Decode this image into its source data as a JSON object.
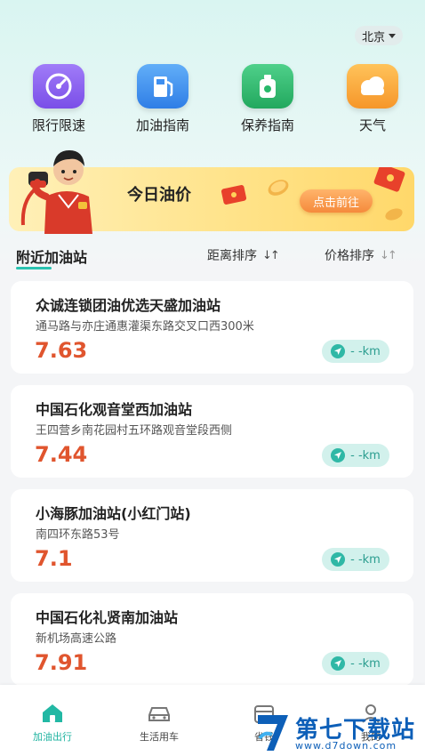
{
  "header": {
    "city": "北京"
  },
  "quick_nav": [
    {
      "label": "限行限速",
      "icon": "speedometer-icon",
      "color": "#8a62f0"
    },
    {
      "label": "加油指南",
      "icon": "fuel-pump-icon",
      "color": "#3e8ff0"
    },
    {
      "label": "保养指南",
      "icon": "oil-bottle-icon",
      "color": "#28b86a"
    },
    {
      "label": "天气",
      "icon": "weather-cloud-icon",
      "color": "#f6a234"
    }
  ],
  "banner": {
    "title": "今日油价",
    "button": "点击前往"
  },
  "list_header": {
    "tab": "附近加油站",
    "sort_distance": "距离排序",
    "sort_price": "价格排序"
  },
  "stations": [
    {
      "name": "众诚连锁团油优选天盛加油站",
      "address": "通马路与亦庄通惠灌渠东路交叉口西300米",
      "price": "7.63",
      "distance": "- -km"
    },
    {
      "name": "中国石化观音堂西加油站",
      "address": "王四营乡南花园村五环路观音堂段西侧",
      "price": "7.44",
      "distance": "- -km"
    },
    {
      "name": "小海豚加油站(小红门站)",
      "address": "南四环东路53号",
      "price": "7.1",
      "distance": "- -km"
    },
    {
      "name": "中国石化礼贤南加油站",
      "address": "新机场高速公路",
      "price": "7.91",
      "distance": "- -km"
    }
  ],
  "bottom_nav": [
    {
      "label": "加油出行",
      "active": true
    },
    {
      "label": "生活用车",
      "active": false
    },
    {
      "label": "省钱",
      "active": false
    },
    {
      "label": "我的",
      "active": false
    }
  ],
  "watermark": {
    "title": "第七下载站",
    "url": "www.d7down.com"
  },
  "colors": {
    "accent": "#29c2b0",
    "price": "#e0552e",
    "banner": "#ffe38a"
  }
}
